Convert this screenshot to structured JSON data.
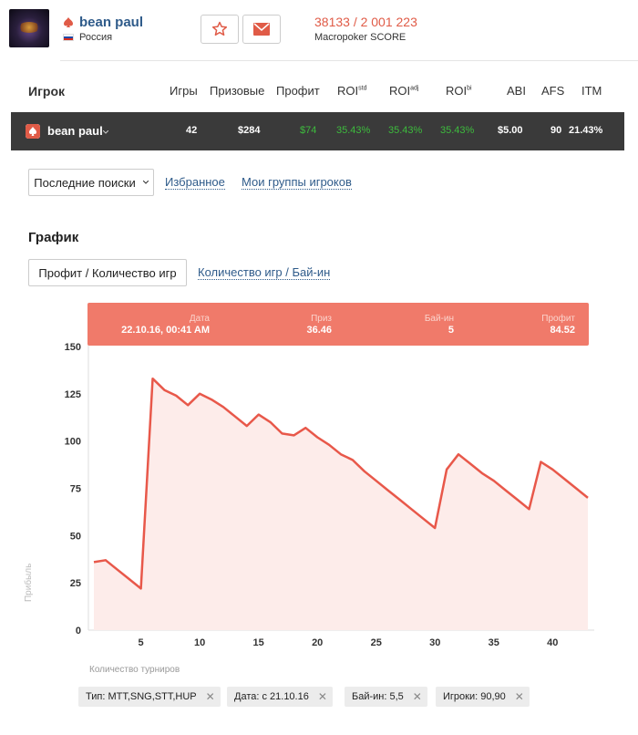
{
  "profile": {
    "name": "bean paul",
    "country": "Россия",
    "score_value": "38133 / 2 001 223",
    "score_label": "Macropoker SCORE"
  },
  "table": {
    "headers": {
      "player": "Игрок",
      "games": "Игры",
      "prizes": "Призовые",
      "profit": "Профит",
      "roi_std": "ROI",
      "roi_std_sup": "std",
      "roi_adj": "ROI",
      "roi_adj_sup": "adj",
      "roi_bi": "ROI",
      "roi_bi_sup": "bi",
      "abi": "ABI",
      "afs": "AFS",
      "itm": "ITM"
    },
    "row": {
      "name": "bean paul",
      "games": "42",
      "prizes": "$284",
      "profit": "$74",
      "roi_std": "35.43%",
      "roi_adj": "35.43%",
      "roi_bi": "35.43%",
      "abi": "$5.00",
      "afs": "90",
      "itm": "21.43%"
    }
  },
  "nav": {
    "recent_searches": "Последние поиски",
    "favorites": "Избранное",
    "groups": "Мои группы игроков"
  },
  "chart_section": {
    "title": "График",
    "tab_active": "Профит / Количество игр",
    "tab_other": "Количество игр / Бай-ин"
  },
  "tooltip": {
    "date_label": "Дата",
    "date_value": "22.10.16, 00:41 AM",
    "prize_label": "Приз",
    "prize_value": "36.46",
    "buyin_label": "Бай-ин",
    "buyin_value": "5",
    "profit_label": "Профит",
    "profit_value": "84.52"
  },
  "chart_data": {
    "type": "area",
    "xlabel": "Количество турниров",
    "ylabel": "Прибыль",
    "xlim": [
      1,
      43
    ],
    "ylim": [
      0,
      150
    ],
    "y_ticks": [
      0,
      25,
      50,
      75,
      100,
      125,
      150
    ],
    "x_ticks": [
      5,
      10,
      15,
      20,
      25,
      30,
      35,
      40
    ],
    "x": [
      1,
      2,
      3,
      4,
      5,
      6,
      7,
      8,
      9,
      10,
      11,
      12,
      13,
      14,
      15,
      16,
      17,
      18,
      19,
      20,
      21,
      22,
      23,
      24,
      25,
      26,
      27,
      28,
      29,
      30,
      31,
      32,
      33,
      34,
      35,
      36,
      37,
      38,
      39,
      40,
      41,
      42,
      43
    ],
    "values": [
      36,
      37,
      32,
      27,
      22,
      133,
      127,
      124,
      119,
      125,
      122,
      118,
      113,
      108,
      114,
      110,
      104,
      103,
      107,
      102,
      98,
      93,
      90,
      84,
      79,
      74,
      69,
      64,
      59,
      54,
      85,
      93,
      88,
      83,
      79,
      74,
      69,
      64,
      89,
      85,
      80,
      75,
      70
    ],
    "color": "#e8584a",
    "fill": "#fdecea"
  },
  "filters": [
    {
      "label": "Тип: MTT,SNG,STT,HUP"
    },
    {
      "label": "Дата: с 21.10.16"
    },
    {
      "label": "Бай-ин: 5,5"
    },
    {
      "label": "Игроки: 90,90"
    }
  ],
  "icons": {
    "favorite": "star-icon",
    "message": "envelope-icon",
    "close": "close-icon"
  },
  "colors": {
    "accent": "#e05b47",
    "link": "#2f5b8a",
    "positive": "#3dbb3d"
  }
}
